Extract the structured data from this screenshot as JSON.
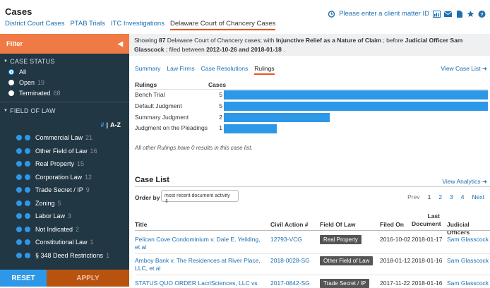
{
  "header": {
    "title": "Cases",
    "tabs": [
      {
        "label": "District Court Cases",
        "active": false
      },
      {
        "label": "PTAB Trials",
        "active": false
      },
      {
        "label": "ITC Investigations",
        "active": false
      },
      {
        "label": "Delaware Court of Chancery Cases",
        "active": true
      }
    ],
    "client_prompt": "Please enter a client matter ID"
  },
  "sidebar": {
    "filter_label": "Filter",
    "case_status_title": "CASE STATUS",
    "statuses": [
      {
        "label": "All",
        "count": "",
        "selected": true
      },
      {
        "label": "Open",
        "count": "19",
        "selected": false
      },
      {
        "label": "Terminated",
        "count": "68",
        "selected": false
      }
    ],
    "field_of_law_title": "FIELD OF LAW",
    "sort_hash": "#",
    "sort_sep": "|",
    "sort_az": "A-Z",
    "laws": [
      {
        "label": "Commercial Law",
        "count": "21"
      },
      {
        "label": "Other Field of Law",
        "count": "16"
      },
      {
        "label": "Real Property",
        "count": "15"
      },
      {
        "label": "Corporation Law",
        "count": "12"
      },
      {
        "label": "Trade Secret / IP",
        "count": "9"
      },
      {
        "label": "Zoning",
        "count": "5"
      },
      {
        "label": "Labor Law",
        "count": "3"
      },
      {
        "label": "Not Indicated",
        "count": "2"
      },
      {
        "label": "Constitutional Law",
        "count": "1"
      },
      {
        "label": "§ 348 Deed Restrictions",
        "count": "1"
      }
    ],
    "reset_label": "RESET",
    "apply_label": "APPLY"
  },
  "summary": {
    "prefix": "Showing ",
    "count": "87",
    "court": " Delaware Court of Chancery cases",
    "mid": ";  with ",
    "relief": "Injunctive Relief as a Nature of Claim",
    "mid2": " ;  before ",
    "judge": "Judicial Officer Sam Glasscock",
    "mid3": " ;  filed between ",
    "range": "2012-10-26 and 2018-01-18",
    "suffix": " ."
  },
  "subtabs": [
    {
      "label": "Summary",
      "active": false
    },
    {
      "label": "Law Firms",
      "active": false
    },
    {
      "label": "Case Resolutions",
      "active": false
    },
    {
      "label": "Rulings",
      "active": true
    }
  ],
  "view_case_list": "View Case List",
  "rulings": {
    "col1": "Rulings",
    "col2": "Cases",
    "rows": [
      {
        "label": "Bench Trial",
        "count": 5
      },
      {
        "label": "Default Judgment",
        "count": 5
      },
      {
        "label": "Summary Judgment",
        "count": 2
      },
      {
        "label": "Judgment on the Pleadings",
        "count": 1
      }
    ],
    "note": "All other Rulings have 0 results in this case list."
  },
  "case_list": {
    "title": "Case List",
    "analytics": "View Analytics",
    "order_label": "Order by",
    "order_value": "most recent document activity",
    "pager": {
      "prev": "Prev",
      "pages": [
        "1",
        "2",
        "3",
        "4"
      ],
      "current": "1",
      "next": "Next"
    },
    "columns": [
      "Title",
      "Civil Action #",
      "Field Of Law",
      "Filed On",
      "Last Document",
      "Judicial Officers"
    ],
    "rows": [
      {
        "title": "Pelican Cove Condominium v. Dale E. Yeilding, et al",
        "civil": "12793-VCG",
        "field": "Real Property",
        "filed": "2016-10-02",
        "last": "2018-01-17",
        "judge": "Sam Glasscock"
      },
      {
        "title": "Amboy Bank v. The Residences at River Place, LLC, et al",
        "civil": "2018-0028-SG",
        "field": "Other Field of Law",
        "filed": "2018-01-12",
        "last": "2018-01-16",
        "judge": "Sam Glasscock"
      },
      {
        "title": "STATUS QUO ORDER LacriSciences, LLC vs",
        "civil": "2017-0842-SG",
        "field": "Trade Secret / IP",
        "filed": "2017-11-22",
        "last": "2018-01-16",
        "judge": "Sam Glasscock"
      }
    ]
  },
  "chart_data": {
    "type": "bar",
    "categories": [
      "Bench Trial",
      "Default Judgment",
      "Summary Judgment",
      "Judgment on the Pleadings"
    ],
    "values": [
      5,
      5,
      2,
      1
    ]
  },
  "colors": {
    "accent": "#e8541e",
    "bar": "#2e98e8",
    "sidebar": "#223744",
    "link": "#1a6fb3"
  }
}
